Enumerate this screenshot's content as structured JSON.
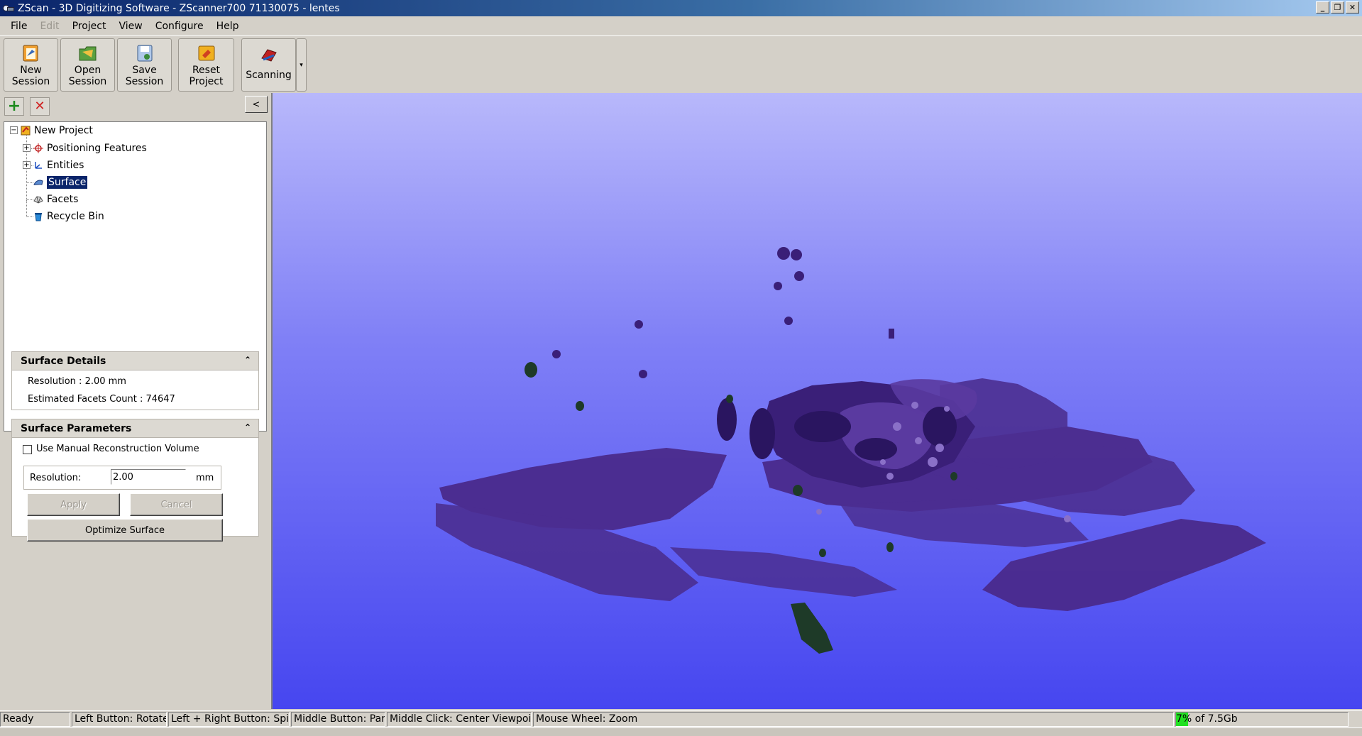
{
  "window": {
    "title": "ZScan - 3D Digitizing Software - ZScanner700 71130075 - lentes",
    "buttons": {
      "minimize": "_",
      "restore": "❐",
      "close": "✕"
    }
  },
  "menu": [
    "File",
    "Edit",
    "Project",
    "View",
    "Configure",
    "Help"
  ],
  "toolbar": {
    "new_session": {
      "line1": "New",
      "line2": "Session"
    },
    "open_session": {
      "line1": "Open",
      "line2": "Session"
    },
    "save_session": {
      "line1": "Save",
      "line2": "Session"
    },
    "reset_project": {
      "line1": "Reset",
      "line2": "Project"
    },
    "scanning": "Scanning",
    "dropdown": "▾"
  },
  "panel": {
    "add_icon": "+",
    "remove_icon": "✕",
    "collapse": "<"
  },
  "tree": {
    "root": "New Project",
    "items": [
      "Positioning Features",
      "Entities",
      "Surface",
      "Facets",
      "Recycle Bin"
    ],
    "selected": "Surface"
  },
  "surface_details": {
    "header": "Surface Details",
    "resolution": "Resolution : 2.00 mm",
    "facets": "Estimated Facets Count : 74647"
  },
  "surface_parameters": {
    "header": "Surface Parameters",
    "manual_volume": "Use Manual Reconstruction Volume",
    "manual_volume_checked": false,
    "resolution_label": "Resolution:",
    "resolution_value": "2.00",
    "unit": "mm",
    "apply": "Apply",
    "cancel": "Cancel",
    "optimize": "Optimize Surface"
  },
  "status": {
    "ready": "Ready",
    "left": "Left Button: Rotate",
    "left_right": "Left + Right Button: Spin",
    "middle": "Middle Button: Pan",
    "middle_click": "Middle Click: Center Viewpoint",
    "wheel": "Mouse Wheel: Zoom",
    "memory": "7% of 7.5Gb",
    "memory_fraction": 0.07
  },
  "colors": {
    "viewport_top": "#b8b8fb",
    "viewport_bottom": "#4646f0",
    "mesh": "#4a2b8c",
    "mesh_dark": "#2a1560",
    "selection": "#0a246a"
  }
}
